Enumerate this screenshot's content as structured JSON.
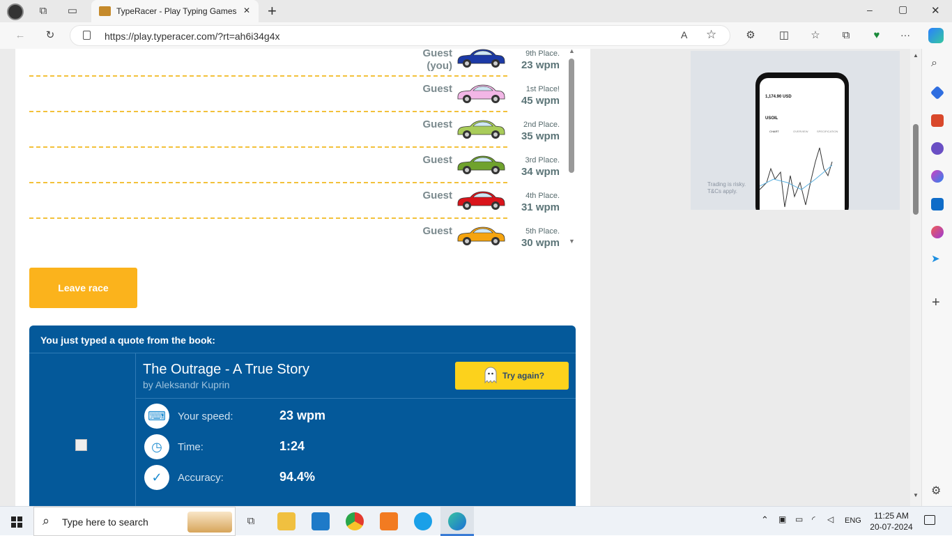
{
  "browser": {
    "tab_title": "TypeRacer - Play Typing Games a",
    "url": "https://play.typeracer.com/?rt=ah6i34g4x",
    "new_tab_label": "+",
    "minimize": "–",
    "maximize": "▢",
    "close": "✕",
    "more": "···"
  },
  "race": {
    "racers": [
      {
        "name_line1": "Guest",
        "name_line2": "(you)",
        "place": "9th Place.",
        "wpm": "23 wpm",
        "car_color": "#1c3aa6"
      },
      {
        "name_line1": "Guest",
        "name_line2": "",
        "place": "1st Place!",
        "wpm": "45 wpm",
        "car_color": "#f2b6e6"
      },
      {
        "name_line1": "Guest",
        "name_line2": "",
        "place": "2nd Place.",
        "wpm": "35 wpm",
        "car_color": "#a9cc5a"
      },
      {
        "name_line1": "Guest",
        "name_line2": "",
        "place": "3rd Place.",
        "wpm": "34 wpm",
        "car_color": "#6fa22d"
      },
      {
        "name_line1": "Guest",
        "name_line2": "",
        "place": "4th Place.",
        "wpm": "31 wpm",
        "car_color": "#d9141b"
      },
      {
        "name_line1": "Guest",
        "name_line2": "",
        "place": "5th Place.",
        "wpm": "30 wpm",
        "car_color": "#f5a40f"
      }
    ],
    "leave_button": "Leave race"
  },
  "book": {
    "header": "You just typed a quote from the book:",
    "title": "The Outrage - A True Story",
    "author": "by Aleksandr Kuprin",
    "try_again": "Try again?",
    "stats": [
      {
        "label": "Your speed:",
        "value": "23 wpm",
        "icon": "keyboard-icon"
      },
      {
        "label": "Time:",
        "value": "1:24",
        "icon": "clock-icon"
      },
      {
        "label": "Accuracy:",
        "value": "94.4%",
        "icon": "check-icon"
      }
    ]
  },
  "ad": {
    "price": "1,174.90 USD",
    "ticker": "USOIL",
    "tabs": [
      "CHART",
      "OVERVIEW",
      "SPECIFICATION"
    ],
    "disclaimer_1": "Trading is risky.",
    "disclaimer_2": "T&Cs apply."
  },
  "taskbar": {
    "search_placeholder": "Type here to search",
    "lang": "ENG",
    "time": "11:25 AM",
    "date": "20-07-2024"
  }
}
